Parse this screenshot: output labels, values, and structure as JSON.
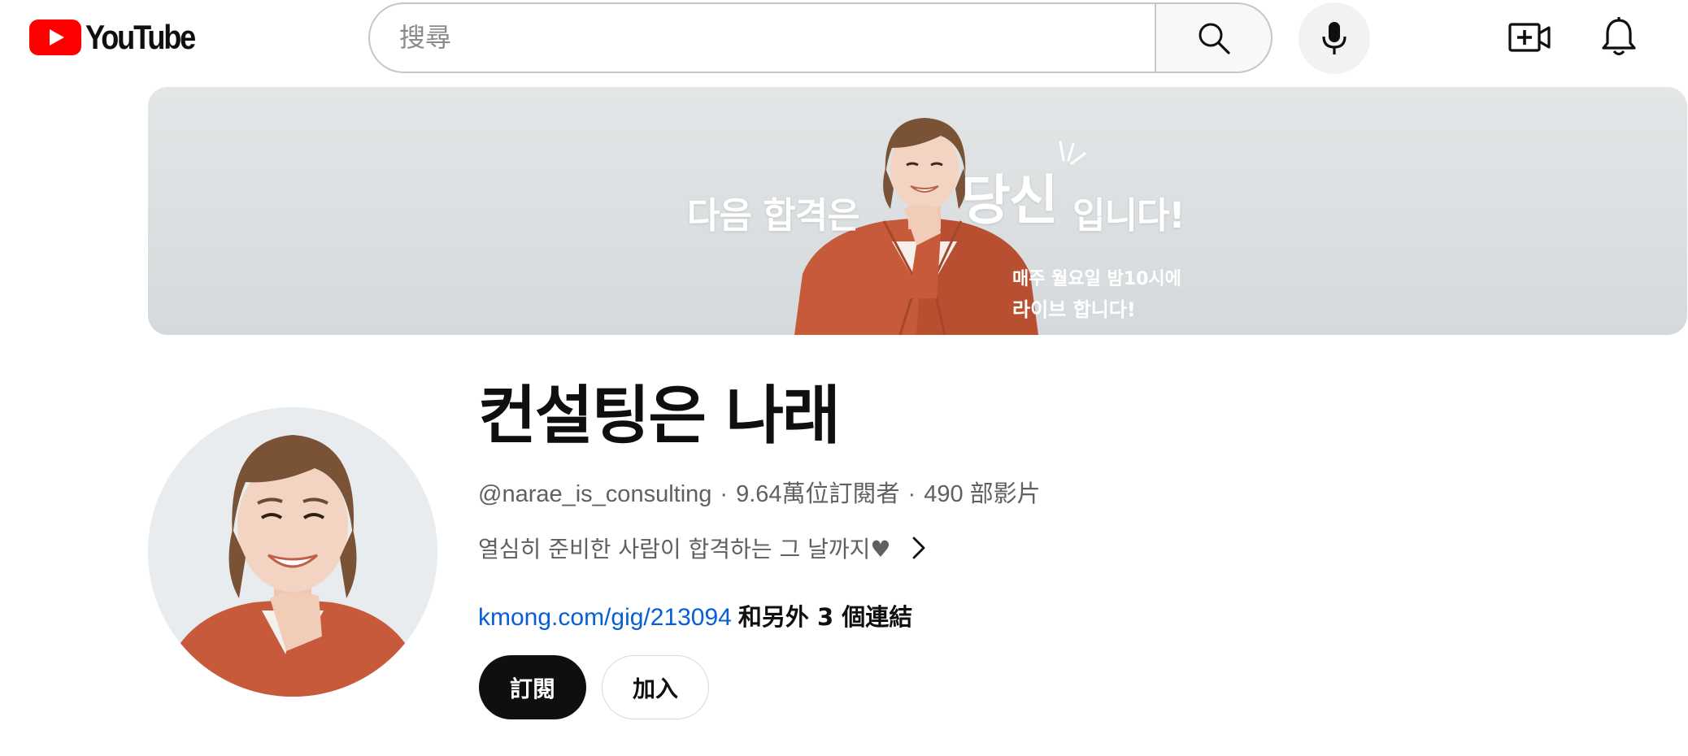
{
  "header": {
    "logo_text": "YouTube",
    "search_placeholder": "搜尋"
  },
  "banner": {
    "line_a": "다음 합격은",
    "line_b": "당신",
    "line_c": "입니다!",
    "schedule_line": "매주 월요일 밤10시에",
    "live_line": "라이브 합니다!"
  },
  "channel": {
    "name": "컨설팅은 나래",
    "handle": "@narae_is_consulting",
    "separator": "·",
    "subscribers": "9.64萬位訂閱者",
    "video_count": "490 部影片",
    "description": "열심히 준비한 사람이 합격하는 그 날까지♥",
    "link_text": "kmong.com/gig/213094",
    "more_links": "和另外 3 個連結",
    "subscribe_label": "訂閱",
    "join_label": "加入"
  },
  "colors": {
    "brand_red": "#ff0000",
    "link_blue": "#065fd4",
    "subscribe_bg": "#0f0f0f",
    "jacket": "#c65a3a"
  }
}
